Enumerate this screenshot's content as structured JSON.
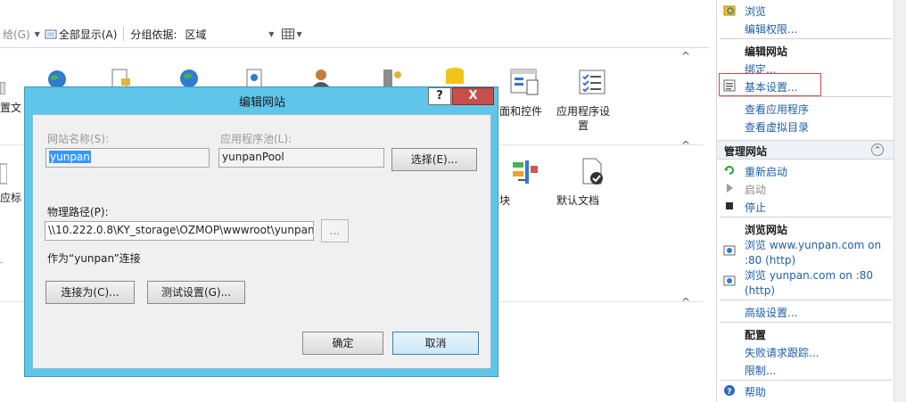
{
  "toolbar": {
    "partial_left": "给(G)",
    "show_all": "全部显示(A)",
    "group_by_label": "分组依据:",
    "group_by_value": "区域"
  },
  "features": {
    "partial_1": "置文",
    "partial_2": "应标",
    "pages_controls": "页面和控件",
    "app_settings": "应用程序设\n置",
    "modules": "模块",
    "default_doc": "默认文档"
  },
  "dialog": {
    "title": "编辑网站",
    "help_btn": "?",
    "close_btn": "X",
    "site_name_label": "网站名称(S):",
    "site_name_value": "yunpan",
    "app_pool_label": "应用程序池(L):",
    "app_pool_value": "yunpanPool",
    "select_btn": "选择(E)...",
    "physical_path_label": "物理路径(P):",
    "physical_path_value": "\\\\10.222.0.8\\KY_storage\\OZMOP\\wwwroot\\yunpan",
    "browse_btn": "...",
    "connect_as_text": "作为“yunpan”连接",
    "connect_as_btn": "连接为(C)...",
    "test_settings_btn": "测试设置(G)...",
    "ok_btn": "确定",
    "cancel_btn": "取消"
  },
  "pane": {
    "browse": "浏览",
    "edit_permissions": "编辑权限...",
    "edit_site_header": "编辑网站",
    "bindings": "绑定...",
    "basic_settings": "基本设置...",
    "view_apps": "查看应用程序",
    "view_vdirs": "查看虚拟目录",
    "manage_site_header": "管理网站",
    "restart": "重新启动",
    "start": "启动",
    "stop": "停止",
    "browse_site_header": "浏览网站",
    "browse_www_1": "浏览 www.yunpan.com on",
    "browse_www_2": ":80 (http)",
    "browse_yp_1": "浏览 yunpan.com on :80",
    "browse_yp_2": "(http)",
    "advanced": "高级设置...",
    "config_header": "配置",
    "failed_trace": "失败请求跟踪...",
    "limits": "限制...",
    "help": "帮助"
  }
}
